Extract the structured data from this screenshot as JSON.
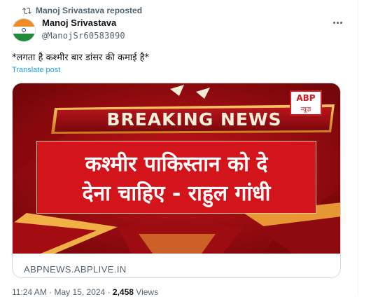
{
  "repost": {
    "text": "Manoj Srivastava reposted",
    "icon": "repost-icon"
  },
  "author": {
    "name": "Manoj Srivastava",
    "handle": "@ManojSr60583090",
    "avatar_icon": "india-flag-avatar"
  },
  "more_icon": "more-icon",
  "tweet": {
    "text": "*लगता है कश्मीर बार डांसर की कमाई है*",
    "translate_label": "Translate post"
  },
  "card": {
    "image": {
      "breaking": "BREAKING NEWS",
      "headline_line1": "कश्मीर पाकिस्तान को दे",
      "headline_line2": "देना चाहिए - राहुल गांधी",
      "logo_text": "ABP",
      "logo_sub": "न्यूज़"
    },
    "url": "ABPNEWS.ABPLIVE.IN"
  },
  "footer": {
    "time": "11:24 AM",
    "dot": "·",
    "date": "May 15, 2024",
    "views_count": "2,458",
    "views_label": "Views"
  },
  "colors": {
    "accent": "#1d9bf0",
    "card_bg": "#a50d12",
    "headline_bg": "#d4141b"
  }
}
